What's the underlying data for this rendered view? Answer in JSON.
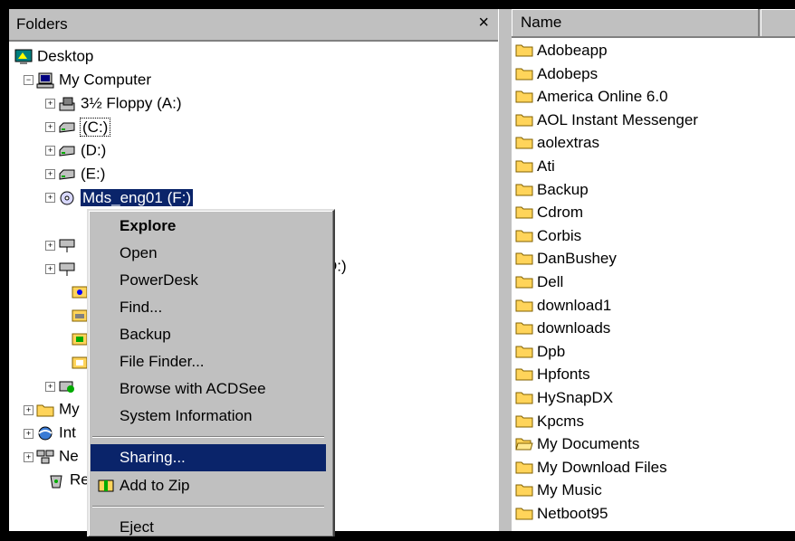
{
  "folders_pane": {
    "title": "Folders",
    "close_glyph": "×",
    "tree": [
      {
        "label": "Desktop",
        "icon": "desktop-icon"
      },
      {
        "label": "My Computer",
        "icon": "computer-icon"
      },
      {
        "label": "3½ Floppy (A:)",
        "icon": "floppy-icon"
      },
      {
        "label": "(C:)",
        "icon": "drive-icon"
      },
      {
        "label": "(D:)",
        "icon": "drive-icon"
      },
      {
        "label": "(E:)",
        "icon": "drive-icon"
      },
      {
        "label": "Mds_eng01 (F:)",
        "icon": "cd-icon"
      },
      {
        "label": "D:)",
        "icon": "network-drive-icon"
      },
      {
        "label": "My",
        "icon": "folder-icon"
      },
      {
        "label": "Int",
        "icon": "internet-icon"
      },
      {
        "label": "Ne",
        "icon": "network-icon"
      },
      {
        "label": "Re",
        "icon": "recycle-bin-icon"
      }
    ]
  },
  "files_pane": {
    "column_name": "Name",
    "files": [
      "Adobeapp",
      "Adobeps",
      "America Online 6.0",
      "AOL Instant Messenger",
      "aolextras",
      "Ati",
      "Backup",
      "Cdrom",
      "Corbis",
      "DanBushey",
      "Dell",
      "download1",
      "downloads",
      "Dpb",
      "Hpfonts",
      "HySnapDX",
      "Kpcms",
      "My Documents",
      "My Download Files",
      "My Music",
      "Netboot95"
    ]
  },
  "context_menu": {
    "items": [
      {
        "label": "Explore",
        "bold": true
      },
      {
        "label": "Open"
      },
      {
        "label": "PowerDesk"
      },
      {
        "label": "Find..."
      },
      {
        "label": "Backup"
      },
      {
        "label": "File Finder..."
      },
      {
        "label": "Browse with ACDSee"
      },
      {
        "label": "System Information"
      },
      {
        "label": "Sharing...",
        "highlighted": true
      },
      {
        "label": "Add to Zip"
      },
      {
        "label": "Eject"
      }
    ]
  },
  "colors": {
    "selection": "#0a246a",
    "chrome": "#c0c0c0",
    "folder_yellow": "#ffd45a"
  }
}
